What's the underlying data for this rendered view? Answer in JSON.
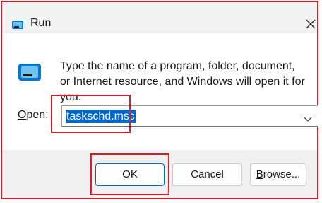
{
  "window": {
    "title": "Run",
    "icon": "run-icon",
    "close_icon": "close-icon"
  },
  "dialog": {
    "message": "Type the name of a program, folder, document, or Internet resource, and Windows will open it for you.",
    "open_label_accel": "O",
    "open_label_rest": "pen:",
    "open_value": "taskschd.msc",
    "dropdown_icon": "chevron-down-icon"
  },
  "buttons": {
    "ok": "OK",
    "cancel": "Cancel",
    "browse_accel": "B",
    "browse_rest": "rowse..."
  },
  "colors": {
    "highlight_frame": "#d21f2b",
    "selection": "#0066cc",
    "ok_border": "#0067c0"
  }
}
